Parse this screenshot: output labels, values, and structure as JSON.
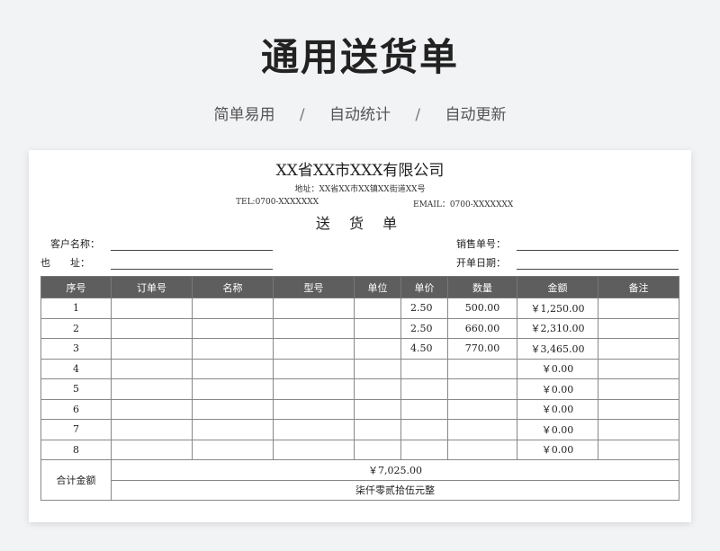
{
  "header": {
    "title": "通用送货单",
    "features": [
      "简单易用",
      "自动统计",
      "自动更新"
    ],
    "separator": "/"
  },
  "document": {
    "company": "XX省XX市XXX有限公司",
    "address": "地址：XX省XX市XX镇XX街道XX号",
    "tel": "TEL:0700-XXXXXXX",
    "email": "EMAIL：0700-XXXXXXX",
    "doc_title": "送 货 单",
    "fields": {
      "customer_name": "客户名称：",
      "address_label": "也　　址：",
      "order_no": "销售单号：",
      "date": "开单日期："
    },
    "columns": [
      "序号",
      "订单号",
      "名称",
      "型号",
      "单位",
      "单价",
      "数量",
      "金额",
      "备注"
    ],
    "rows": [
      {
        "no": "1",
        "order": "",
        "name": "",
        "model": "",
        "unit": "",
        "price": "2.50",
        "qty": "500.00",
        "amount": "￥1,250.00",
        "note": ""
      },
      {
        "no": "2",
        "order": "",
        "name": "",
        "model": "",
        "unit": "",
        "price": "2.50",
        "qty": "660.00",
        "amount": "￥2,310.00",
        "note": ""
      },
      {
        "no": "3",
        "order": "",
        "name": "",
        "model": "",
        "unit": "",
        "price": "4.50",
        "qty": "770.00",
        "amount": "￥3,465.00",
        "note": ""
      },
      {
        "no": "4",
        "order": "",
        "name": "",
        "model": "",
        "unit": "",
        "price": "",
        "qty": "",
        "amount": "￥0.00",
        "note": ""
      },
      {
        "no": "5",
        "order": "",
        "name": "",
        "model": "",
        "unit": "",
        "price": "",
        "qty": "",
        "amount": "￥0.00",
        "note": ""
      },
      {
        "no": "6",
        "order": "",
        "name": "",
        "model": "",
        "unit": "",
        "price": "",
        "qty": "",
        "amount": "￥0.00",
        "note": ""
      },
      {
        "no": "7",
        "order": "",
        "name": "",
        "model": "",
        "unit": "",
        "price": "",
        "qty": "",
        "amount": "￥0.00",
        "note": ""
      },
      {
        "no": "8",
        "order": "",
        "name": "",
        "model": "",
        "unit": "",
        "price": "",
        "qty": "",
        "amount": "￥0.00",
        "note": ""
      }
    ],
    "total": {
      "label": "合计金额",
      "amount": "￥7,025.00",
      "amount_words": "柒仟零贰拾伍元整"
    }
  }
}
